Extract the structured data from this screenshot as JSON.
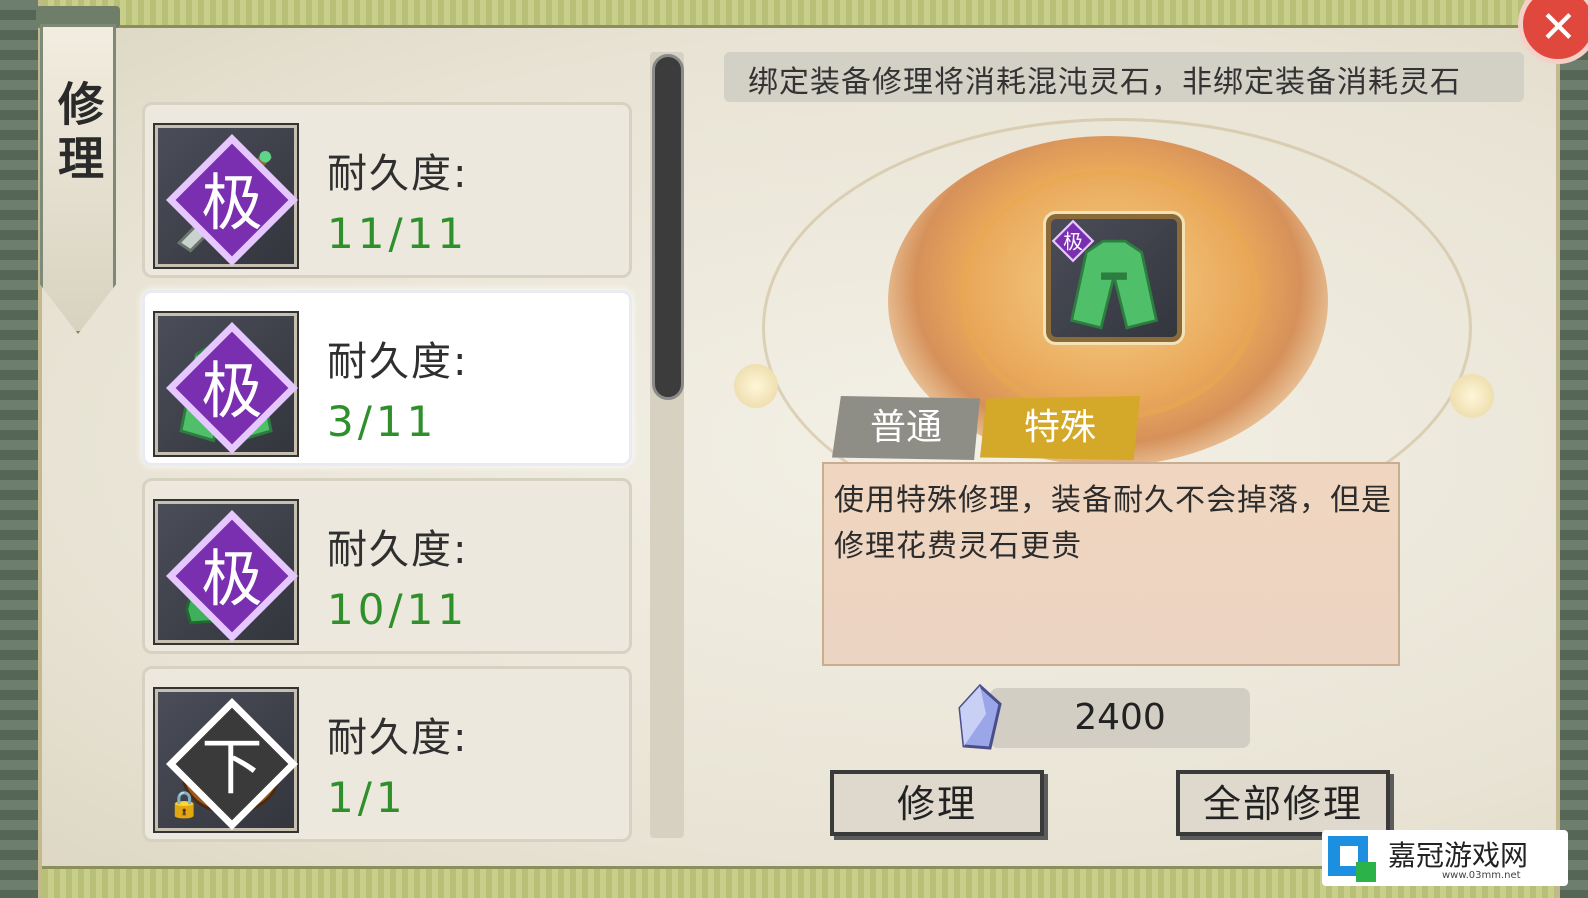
{
  "window": {
    "title": "修理"
  },
  "banner": {
    "text": "绑定装备修理将消耗混沌灵石，非绑定装备消耗灵石"
  },
  "items": [
    {
      "grade": "极",
      "icon": "sword-icon",
      "label": "耐久度:",
      "value": "11/11",
      "selected": false,
      "locked": false
    },
    {
      "grade": "极",
      "icon": "robe-icon",
      "label": "耐久度:",
      "value": "3/11",
      "selected": true,
      "locked": false
    },
    {
      "grade": "极",
      "icon": "boots-icon",
      "label": "耐久度:",
      "value": "10/11",
      "selected": false,
      "locked": false
    },
    {
      "grade": "下",
      "icon": "pouch-icon",
      "label": "耐久度:",
      "value": "1/1",
      "selected": false,
      "locked": true
    }
  ],
  "selected_item": {
    "grade": "极",
    "icon": "robe-icon"
  },
  "tabs": {
    "normal": "普通",
    "special": "特殊",
    "active": "special"
  },
  "description": "使用特殊修理，装备耐久不会掉落，但是修理花费灵石更贵",
  "cost": {
    "icon": "spirit-stone-icon",
    "value": "2400"
  },
  "buttons": {
    "repair": "修理",
    "repair_all": "全部修理"
  },
  "watermark": {
    "text": "嘉冠游戏网",
    "url": "www.03mm.net"
  },
  "colors": {
    "durability": "#2f8f2a",
    "special_tab": "#d4a92a",
    "normal_tab": "#8e8e86",
    "grade_badge": "#7a2fb0"
  }
}
